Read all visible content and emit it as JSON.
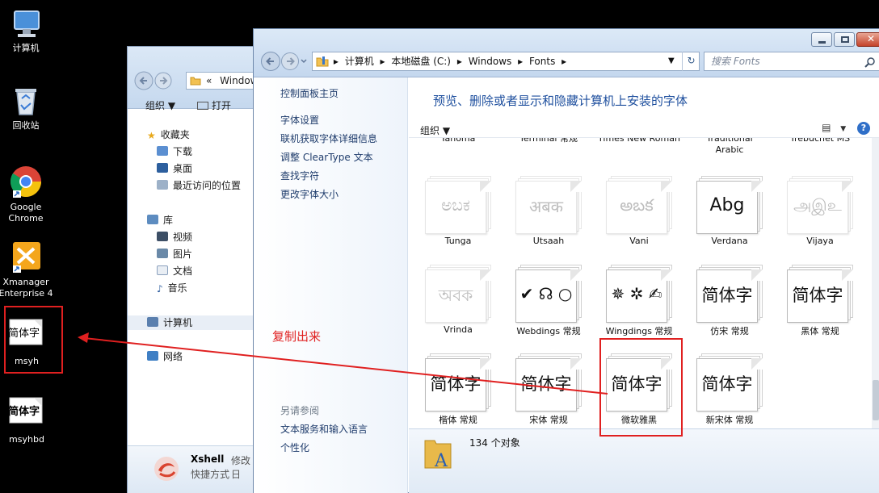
{
  "desktop": {
    "icons": [
      {
        "name": "computer",
        "label": "计算机"
      },
      {
        "name": "recycle",
        "label": "回收站"
      },
      {
        "name": "chrome",
        "label": "Google Chrome"
      },
      {
        "name": "xmanager",
        "label": "Xmanager Enterprise 4"
      },
      {
        "name": "msyh",
        "label": "msyh",
        "glyph": "简体字"
      },
      {
        "name": "msyhbd",
        "label": "msyhbd",
        "glyph": "简体字"
      }
    ]
  },
  "back_window": {
    "address_prefix": "«",
    "address_text": "Windows",
    "toolbar": {
      "organize": "组织 ▼",
      "open": "打开"
    },
    "nav": {
      "favorites": "收藏夹",
      "downloads": "下载",
      "desktop": "桌面",
      "recent": "最近访问的位置",
      "libraries": "库",
      "videos": "视频",
      "pictures": "图片",
      "documents": "文档",
      "music": "音乐",
      "computer": "计算机",
      "network": "网络"
    },
    "status": {
      "name": "Xshell",
      "date_label": "修改日",
      "type": "快捷方式"
    }
  },
  "front_window": {
    "breadcrumb": [
      "计算机",
      "本地磁盘 (C:)",
      "Windows",
      "Fonts"
    ],
    "search_placeholder": "搜索 Fonts",
    "left_pane": {
      "home": "控制面板主页",
      "links": [
        "字体设置",
        "联机获取字体详细信息",
        "调整 ClearType 文本",
        "查找字符",
        "更改字体大小"
      ],
      "see_also": "另请参阅",
      "see_also_links": [
        "文本服务和输入语言",
        "个性化"
      ]
    },
    "content_title": "预览、删除或者显示和隐藏计算机上安装的字体",
    "organize": "组织 ▼",
    "top_row_names": [
      "Tahoma",
      "Terminal 常规",
      "Times New Roman",
      "Traditional Arabic",
      "Trebuchet MS"
    ],
    "fonts": [
      {
        "name": "Tunga",
        "sample": "ಅಬಕ",
        "faded": true
      },
      {
        "name": "Utsaah",
        "sample": "अबक",
        "faded": true
      },
      {
        "name": "Vani",
        "sample": "అబక",
        "faded": true
      },
      {
        "name": "Verdana",
        "sample": "Abg",
        "faded": false
      },
      {
        "name": "Vijaya",
        "sample": "அஇஉ",
        "faded": true
      },
      {
        "name": "Vrinda",
        "sample": "অবক",
        "faded": true
      },
      {
        "name": "Webdings 常规",
        "sample": "✔ ☊ ○",
        "faded": false
      },
      {
        "name": "Wingdings 常规",
        "sample": "✵ ✲ ✍",
        "faded": false
      },
      {
        "name": "仿宋 常规",
        "sample": "简体字",
        "faded": false
      },
      {
        "name": "黑体 常规",
        "sample": "简体字",
        "faded": false
      },
      {
        "name": "楷体 常规",
        "sample": "简体字",
        "faded": false
      },
      {
        "name": "宋体 常规",
        "sample": "简体字",
        "faded": false
      },
      {
        "name": "微软雅黑",
        "sample": "简体字",
        "faded": false
      },
      {
        "name": "新宋体 常规",
        "sample": "简体字",
        "faded": false
      }
    ],
    "status_count": "134 个对象"
  },
  "annotation": {
    "text": "复制出来",
    "color": "#e02020"
  }
}
